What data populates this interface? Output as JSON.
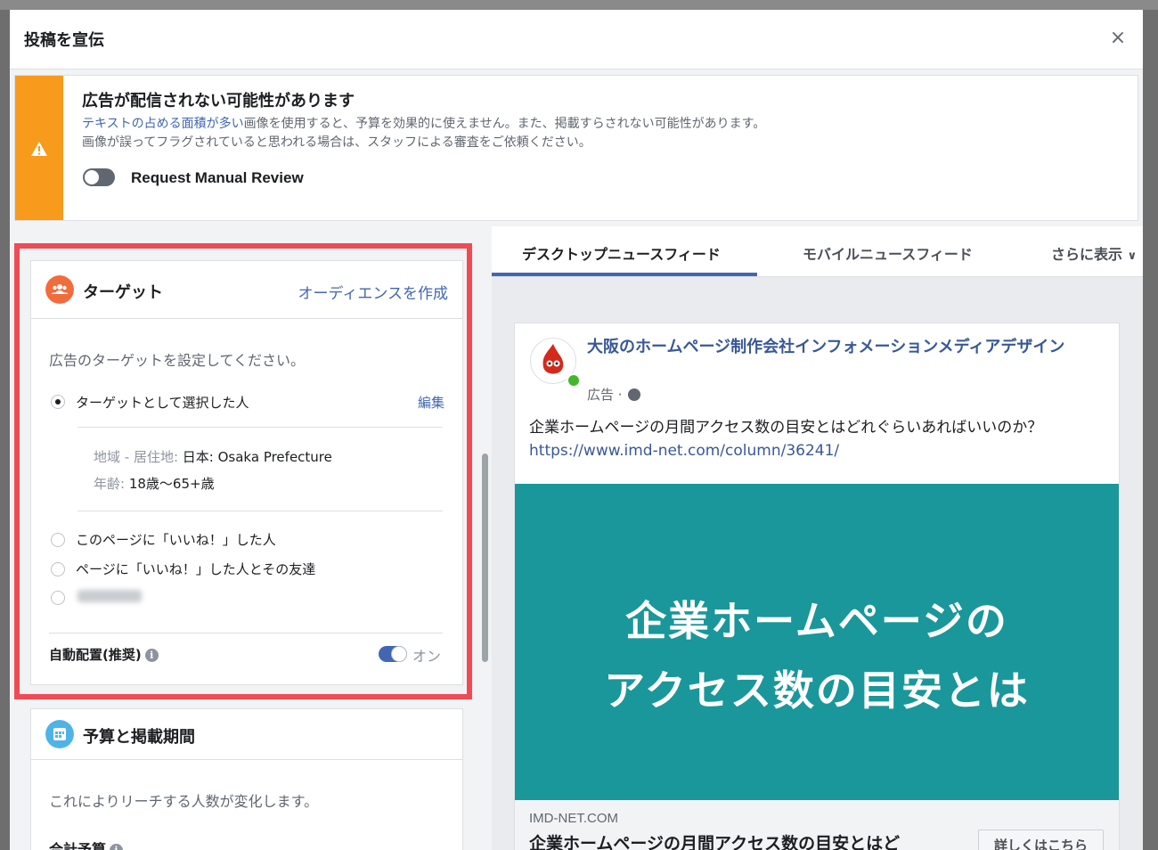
{
  "modal": {
    "title": "投稿を宣伝",
    "close_label": "×"
  },
  "warning": {
    "title": "広告が配信されない可能性があります",
    "link_text": "テキストの占める面積が多い",
    "line1_rest": "画像を使用すると、予算を効果的に使えません。また、掲載すらされない可能性があります。",
    "line2": "画像が誤ってフラグされていると思われる場合は、スタッフによる審査をご依頼ください。",
    "toggle_label": "Request Manual Review",
    "toggle_on": false,
    "accent_color": "#f89a1c"
  },
  "target": {
    "title": "ターゲット",
    "create_audience": "オーディエンスを作成",
    "description": "広告のターゲットを設定してください。",
    "options": [
      {
        "label": "ターゲットとして選択した人",
        "selected": true
      },
      {
        "label": "このページに「いいね！」した人",
        "selected": false
      },
      {
        "label": "ページに「いいね！」した人とその友達",
        "selected": false
      }
    ],
    "edit_label": "編集",
    "location_key": "地域 - 居住地:",
    "location_value": "日本: Osaka Prefecture",
    "age_key": "年齢:",
    "age_value": "18歳〜65+歳",
    "auto_placement": "自動配置(推奨)",
    "info_glyph": "i",
    "toggle_state": "オン"
  },
  "budget": {
    "title": "予算と掲載期間",
    "description": "これによりリーチする人数が変化します。",
    "total_label": "合計予算",
    "info_glyph": "i"
  },
  "preview_tabs": [
    {
      "label": "デスクトップニュースフィード",
      "active": true
    },
    {
      "label": "モバイルニュースフィード",
      "active": false
    },
    {
      "label": "さらに表示",
      "active": false
    }
  ],
  "more_chevron": "∨",
  "post": {
    "page_name": "大阪のホームページ制作会社インフォメーションメディアデザイン",
    "sponsored": "広告 ·",
    "text": "企業ホームページの月間アクセス数の目安とはどれぐらいあればいいのか？",
    "url": "https://www.imd-net.com/column/36241/",
    "image_line1": "企業ホームページの",
    "image_line2": "アクセス数の目安とは",
    "image_color": "#1a979a",
    "domain": "IMD-NET.COM",
    "link_title": "企業ホームページの月間アクセス数の目安とはど",
    "cta": "詳しくはこちら"
  }
}
